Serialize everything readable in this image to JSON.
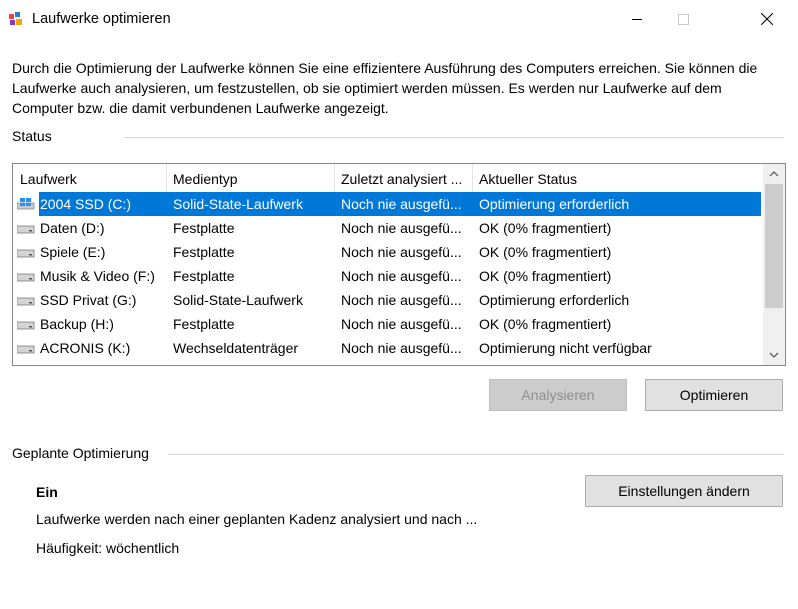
{
  "window": {
    "title": "Laufwerke optimieren",
    "icon": "defrag-app-icon",
    "controls": [
      "minimize",
      "maximize",
      "close"
    ]
  },
  "intro_text": "Durch die Optimierung der Laufwerke können Sie eine effizientere Ausführung des Computers erreichen. Sie können die Laufwerke auch analysieren, um festzustellen, ob sie optimiert werden müssen. Es werden nur Laufwerke auf dem Computer bzw. die damit verbundenen Laufwerke angezeigt.",
  "status": {
    "label": "Status",
    "columns": [
      "Laufwerk",
      "Medientyp",
      "Zuletzt analysiert ...",
      "Aktueller Status"
    ],
    "rows": [
      {
        "drive": "2004 SSD (C:)",
        "media": "Solid-State-Laufwerk",
        "last": "Noch nie ausgefü...",
        "status": "Optimierung erforderlich",
        "icon": "windows-drive-icon",
        "selected": true
      },
      {
        "drive": "Daten (D:)",
        "media": "Festplatte",
        "last": "Noch nie ausgefü...",
        "status": "OK (0% fragmentiert)",
        "icon": "drive-icon"
      },
      {
        "drive": "Spiele (E:)",
        "media": "Festplatte",
        "last": "Noch nie ausgefü...",
        "status": "OK (0% fragmentiert)",
        "icon": "drive-icon"
      },
      {
        "drive": "Musik & Video (F:)",
        "media": "Festplatte",
        "last": "Noch nie ausgefü...",
        "status": "OK (0% fragmentiert)",
        "icon": "drive-icon"
      },
      {
        "drive": "SSD Privat (G:)",
        "media": "Solid-State-Laufwerk",
        "last": "Noch nie ausgefü...",
        "status": "Optimierung erforderlich",
        "icon": "drive-icon"
      },
      {
        "drive": "Backup (H:)",
        "media": "Festplatte",
        "last": "Noch nie ausgefü...",
        "status": "OK (0% fragmentiert)",
        "icon": "drive-icon"
      },
      {
        "drive": "ACRONIS (K:)",
        "media": "Wechseldatenträger",
        "last": "Noch nie ausgefü...",
        "status": "Optimierung nicht verfügbar",
        "icon": "drive-icon"
      }
    ]
  },
  "buttons": {
    "analyze": "Analysieren",
    "optimize": "Optimieren",
    "change_settings": "Einstellungen ändern"
  },
  "scheduled": {
    "label": "Geplante Optimierung",
    "state": "Ein",
    "description": "Laufwerke werden nach einer geplanten Kadenz analysiert und nach ...",
    "frequency": "Häufigkeit: wöchentlich"
  },
  "colors": {
    "selection": "#0078d7",
    "background": "#ffffff"
  }
}
